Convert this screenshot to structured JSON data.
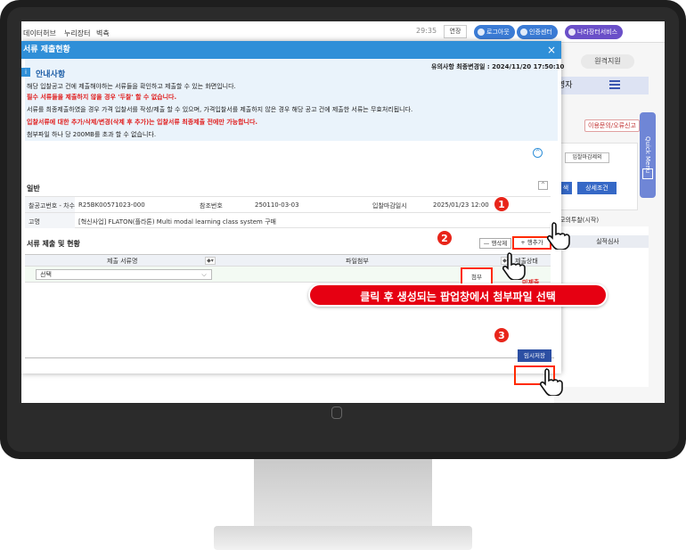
{
  "topbar": {
    "nav": [
      "데이터허브",
      "누리장터",
      "벽츅"
    ],
    "time": "29:35",
    "extend_label": "연장",
    "logout": "로그아웃",
    "cert_center": "인증센터",
    "service": "나라장터서비스"
  },
  "right_panel": {
    "remote_support": "원격지원",
    "user_tab": "영자",
    "quick_menu": "Quick Menu",
    "error_report": "이용문의/오류신고",
    "deadline_exclude": "입찰마감제외",
    "search_btn": "색",
    "detail_cond": "상세조건",
    "mock_bid": "모의투찰(시작)",
    "col_review": "실적심사"
  },
  "modal": {
    "title": "서류 제출현황",
    "close": "×",
    "notice": {
      "icon": "i",
      "title": "안내사항",
      "updated": "유의사항 최종변경일 : 2024/11/20 17:50:10",
      "lines": [
        "해당 입찰공고 건에 제출해야하는 서류들을 확인하고 제출할 수 있는 화면입니다.",
        "필수 서류들을 제출하지 않을 경우 '두찰' 할 수 없습니다.",
        "서류를 최종제출하였을 경우 가격 입찰서를 작성/제출 할 수 있으며, 가격입찰서를 제출하지 않은 경우 해당 공고 건에 제출한 서류는 무효처리됩니다.",
        "입찰서류에 대한 추가/삭제/변경(삭제 후 추가)는 입찰서류 최종제출 전에만 가능합니다.",
        "첨부파일 하나 당 200MB를 초과 할 수 없습니다."
      ]
    },
    "general": {
      "title": "일반",
      "bid_no_label": "찰공고번호 - 차수",
      "bid_no": "R25BK00571023-000",
      "ref_label": "참조번호",
      "ref_no": "250110-03-03",
      "deadline_label": "입찰마감일시",
      "deadline": "2025/01/23 12:00",
      "name_label": "고명",
      "name": "[혁신사업] FLATON(플라톤) Multi modal learning class system 구매"
    },
    "docs": {
      "title": "서류 제출 및 현황",
      "delete_row": "행삭제",
      "add_row": "행추가",
      "col_doc": "제출 서류명",
      "col_file": "파일첨부",
      "col_status": "제출상태",
      "select_placeholder": "선택",
      "attach": "첨부",
      "status": "미제출"
    },
    "save": "임시저장"
  },
  "overlay": {
    "steps": [
      "1",
      "2",
      "3"
    ],
    "banner": "클릭 후 생성되는 팝업창에서 첨부파일 선택"
  }
}
